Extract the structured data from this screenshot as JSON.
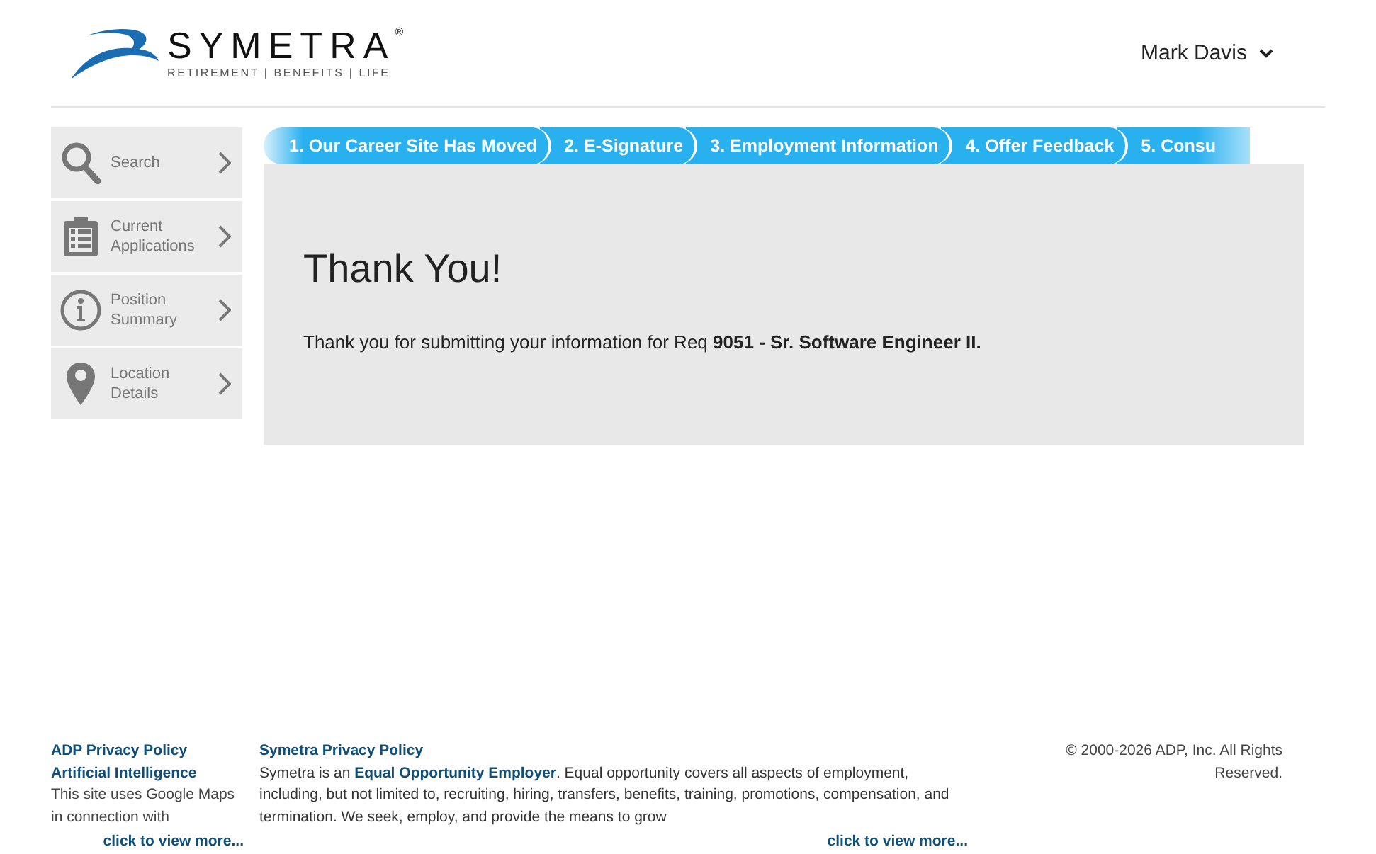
{
  "header": {
    "logo": {
      "name": "SYMETRA",
      "mark": "®",
      "tagline": "RETIREMENT | BENEFITS | LIFE"
    },
    "user": {
      "name": "Mark Davis"
    }
  },
  "sidebar": {
    "items": [
      {
        "kind": "search",
        "label": "Search"
      },
      {
        "kind": "clipboard",
        "label": "Current Applications"
      },
      {
        "kind": "info",
        "label": "Position Summary"
      },
      {
        "kind": "pin",
        "label": "Location Details"
      }
    ]
  },
  "steps": [
    {
      "label": "1. Our Career Site Has Moved"
    },
    {
      "label": "2. E-Signature"
    },
    {
      "label": "3. Employment Information"
    },
    {
      "label": "4. Offer Feedback"
    },
    {
      "label": "5. Consu"
    }
  ],
  "panel": {
    "title": "Thank You!",
    "message": "Thank you for submitting your information for Req **9051 - Sr. Software Engineer II.**"
  },
  "footer": {
    "links": [
      "ADP Privacy Policy",
      "Artificial Intelligence"
    ],
    "maps_note": "This site uses Google Maps in connection with",
    "left_more": "click to view more...",
    "privacy_link": "Symetra Privacy Policy",
    "eeo_text": "Symetra is an **Equal Opportunity Employer**. Equal opportunity covers all aspects of employment, including, but not limited to, recruiting, hiring, transfers, benefits, training, promotions, compensation, and termination. We seek, employ, and provide the means to grow",
    "middle_more": "click to view more...",
    "copyright": "© 2000-2026 ADP, Inc. All Rights Reserved."
  }
}
